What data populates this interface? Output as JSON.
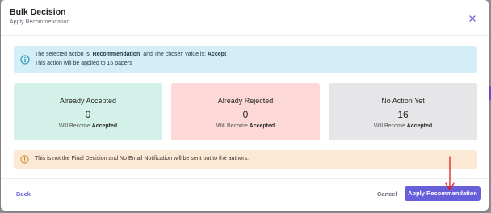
{
  "dialog": {
    "title": "Bulk Decision",
    "subtitle": "Apply Recommendation",
    "close_icon": "close-icon"
  },
  "info_alert": {
    "icon": "info-circle-icon",
    "prefix": "The selected action is: ",
    "action": "Recommendation",
    "middle": ", and The chosen value is: ",
    "value": "Accept",
    "line2": "This action will be applied to 16 papers"
  },
  "summary_cards": [
    {
      "title": "Already Accepted",
      "count": "0",
      "note_prefix": "Will Become ",
      "note_value": "Accepted",
      "color": "#d3f1e8"
    },
    {
      "title": "Already Rejected",
      "count": "0",
      "note_prefix": "Will Become ",
      "note_value": "Accepted",
      "color": "#fcd9d6"
    },
    {
      "title": "No Action Yet",
      "count": "16",
      "note_prefix": "Will Become ",
      "note_value": "Accepted",
      "color": "#e6e6e9"
    }
  ],
  "warning_alert": {
    "icon": "warning-circle-icon",
    "text": "This is not the Final Decision and No Email Notification will be sent out to the authors."
  },
  "footer": {
    "back_label": "Back",
    "cancel_label": "Cancel",
    "apply_label": "Apply Recommendation"
  },
  "colors": {
    "accent": "#675fd9",
    "info_bg": "#d3eef6",
    "warning_bg": "#fbe9d6",
    "annotation_arrow": "#e0201a"
  }
}
